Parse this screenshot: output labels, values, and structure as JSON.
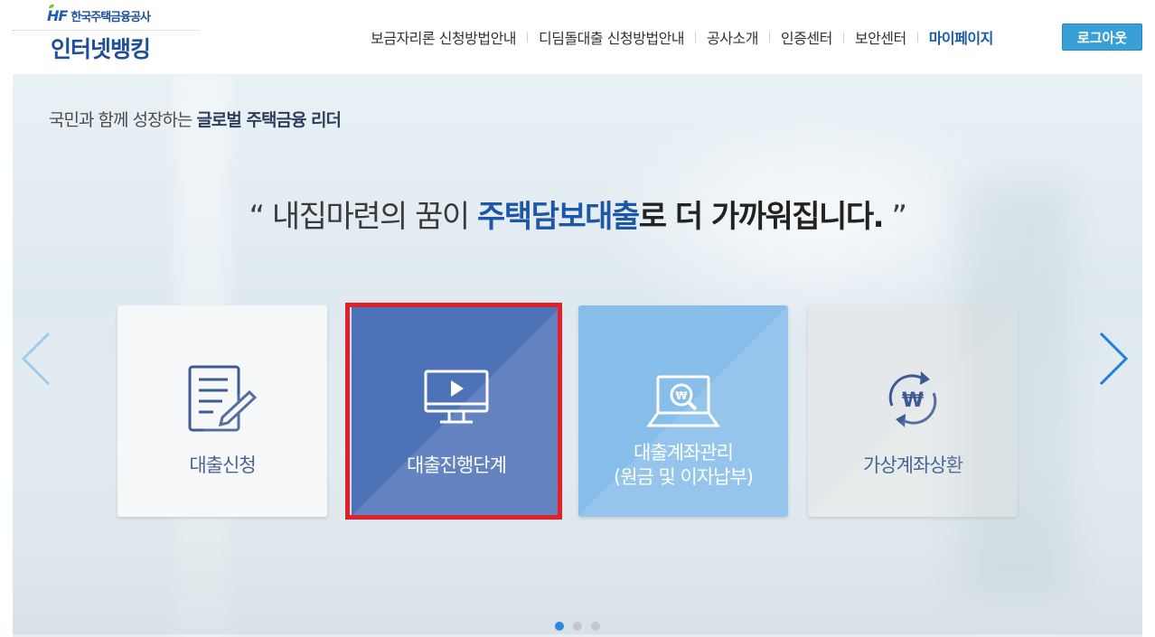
{
  "header": {
    "org_name": "한국주택금융공사",
    "hf_logo": "HF",
    "service_title": "인터넷뱅킹",
    "nav": [
      {
        "label": "보금자리론 신청방법안내"
      },
      {
        "label": "디딤돌대출 신청방법안내"
      },
      {
        "label": "공사소개"
      },
      {
        "label": "인증센터"
      },
      {
        "label": "보안센터"
      },
      {
        "label": "마이페이지"
      }
    ],
    "logout_label": "로그아웃"
  },
  "hero": {
    "slogan_normal": "국민과 함께 성장하는",
    "slogan_bold": "글로벌 주택금융 리더",
    "headline_open": "“ 내집마련의 꿈이",
    "headline_highlight": "주택담보대출",
    "headline_bold": "로 더 가까워집니다.",
    "headline_close": "”"
  },
  "cards": [
    {
      "label": "대출신청",
      "icon": "document-pen-icon"
    },
    {
      "label": "대출진행단계",
      "icon": "monitor-play-icon"
    },
    {
      "label_line1": "대출계좌관리",
      "label_line2": "(원금 및 이자납부)",
      "icon": "laptop-won-search-icon"
    },
    {
      "label": "가상계좌상환",
      "icon": "won-cycle-icon"
    }
  ],
  "carousel": {
    "dot_count": 3,
    "active_dot": 1
  },
  "colors": {
    "brand_blue": "#1f4f99",
    "accent_blue": "#1d57a6",
    "logout_bg": "#3a9fd6",
    "card_active": "#4e72b8",
    "card_light_blue": "#86bde9",
    "highlight_red": "#e2202a",
    "arrow_left": "#9fcdeb",
    "arrow_right": "#1e7fe0"
  }
}
